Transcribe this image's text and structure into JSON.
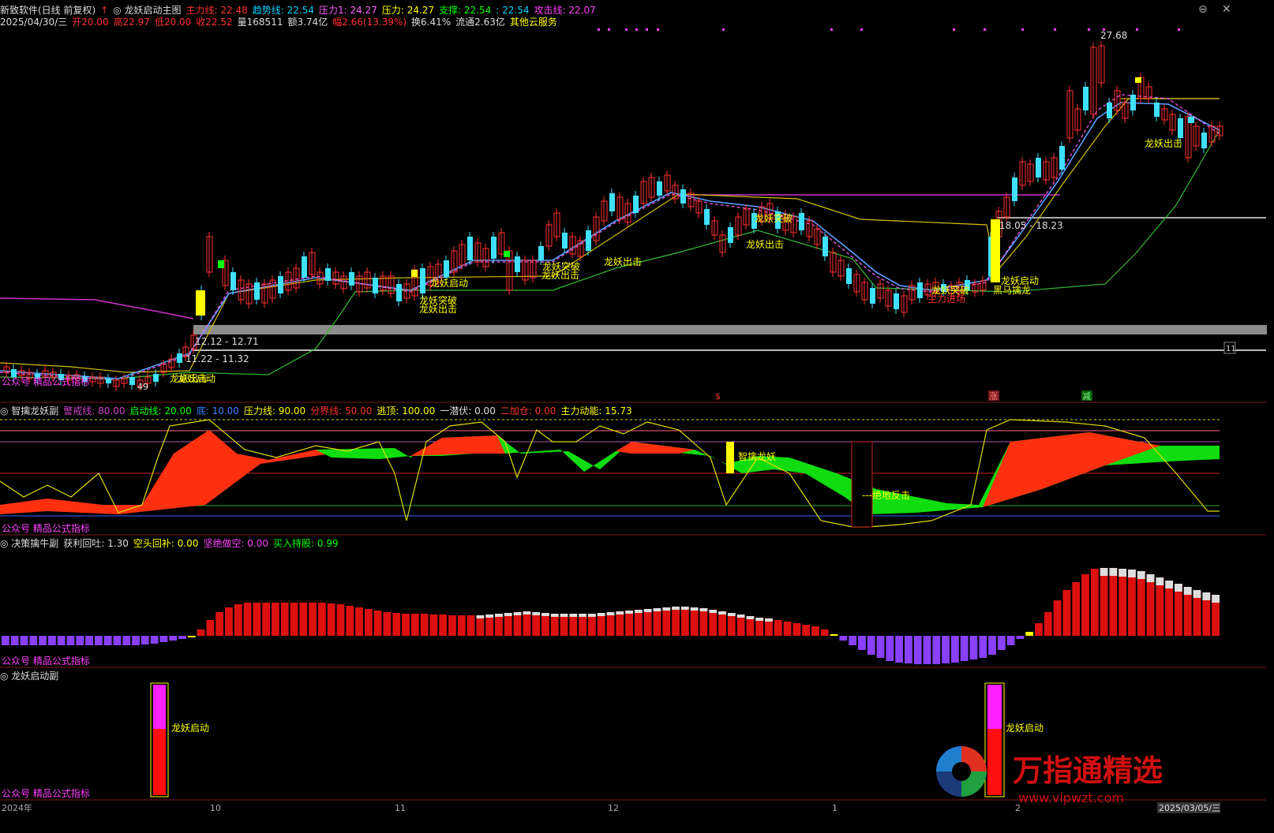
{
  "main": {
    "title_row": [
      {
        "text": "新致软件(日线 前复权)",
        "color": "#dddddd"
      },
      {
        "text": "↑",
        "color": "#ff3030"
      },
      {
        "text": "◎ 龙妖启动主图",
        "color": "#dddddd"
      },
      {
        "text": "主力线: 22.48",
        "color": "#ff3030"
      },
      {
        "text": "趋势线: 22.54",
        "color": "#00d0ff"
      },
      {
        "text": "压力1: 24.27",
        "color": "#ff60ff"
      },
      {
        "text": "压力: 24.27",
        "color": "#ffff00"
      },
      {
        "text": "支撑: 22.54",
        "color": "#00ff00"
      },
      {
        "text": ": 22.54",
        "color": "#00d0ff"
      },
      {
        "text": "攻击线: 22.07",
        "color": "#ff40ff"
      }
    ],
    "info_row": [
      {
        "text": "2025/04/30/三",
        "color": "#dddddd"
      },
      {
        "text": "开20.00",
        "color": "#ff3030"
      },
      {
        "text": "高22.97",
        "color": "#ff3030"
      },
      {
        "text": "低20.00",
        "color": "#ff3030"
      },
      {
        "text": "收22.52",
        "color": "#ff3030"
      },
      {
        "text": "量168511",
        "color": "#dddddd"
      },
      {
        "text": "额3.74亿",
        "color": "#dddddd"
      },
      {
        "text": "幅2.66(13.39%)",
        "color": "#ff3030"
      },
      {
        "text": "换6.41%",
        "color": "#dddddd"
      },
      {
        "text": "流通2.63亿",
        "color": "#dddddd"
      },
      {
        "text": "其他云服务",
        "color": "#ffff00"
      }
    ],
    "max_label": "27.68",
    "range_high": "18.05 - 18.23",
    "range_mid": "12.12 - 12.71",
    "range_low": "11.22 - 11.32",
    "low_label": "49",
    "right_edge_label": "11",
    "signals": [
      {
        "text": "龙妖启动",
        "color": "#ffff00"
      },
      {
        "text": "龙妖突破",
        "color": "#ffff00"
      },
      {
        "text": "龙妖出击",
        "color": "#ffff00"
      },
      {
        "text": "龙妖突破",
        "color": "#ffff00"
      },
      {
        "text": "龙妖出击",
        "color": "#ffff00"
      },
      {
        "text": "龙妖出击",
        "color": "#ffff00"
      },
      {
        "text": "龙妖出击",
        "color": "#ffff00"
      },
      {
        "text": "龙妖突破",
        "color": "#ffff00"
      },
      {
        "text": "主力进场",
        "color": "#ff3030"
      },
      {
        "text": "龙妖启动",
        "color": "#ffff00"
      },
      {
        "text": "黑马擒龙",
        "color": "#ffff00"
      },
      {
        "text": "龙妖出击",
        "color": "#ffff00"
      },
      {
        "text": "龙妖启动",
        "color": "#ffff00"
      },
      {
        "text": "龙妖突破",
        "color": "#ffff00"
      },
      {
        "text": "龙妖出击",
        "color": "#ffff00"
      }
    ],
    "bottom_marks": [
      {
        "text": "$",
        "color": "#ff3030"
      },
      {
        "text": "涨",
        "color": "#ff3030"
      },
      {
        "text": "减",
        "color": "#00ff00"
      }
    ],
    "watermark": "公众号 精品公式指标"
  },
  "panel2": {
    "header": [
      {
        "text": "◎ 智擒龙妖副",
        "color": "#dddddd"
      },
      {
        "text": "警戒线: 80.00",
        "color": "#cc44cc"
      },
      {
        "text": "启动线: 20.00",
        "color": "#00ff00"
      },
      {
        "text": "底: 10.00",
        "color": "#4080ff"
      },
      {
        "text": "压力线: 90.00",
        "color": "#ffff00"
      },
      {
        "text": "分界线: 50.00",
        "color": "#ff3030"
      },
      {
        "text": "逃顶: 100.00",
        "color": "#ffff00"
      },
      {
        "text": "一潜伏: 0.00",
        "color": "#dddddd"
      },
      {
        "text": "二加仓: 0.00",
        "color": "#ff3030"
      },
      {
        "text": "主力动能: 15.73",
        "color": "#ffff00"
      }
    ],
    "label_1": "智擒龙妖",
    "label_2": "---绝地反击",
    "watermark": "公众号 精品公式指标"
  },
  "panel3": {
    "header": [
      {
        "text": "◎ 决策擒牛副",
        "color": "#dddddd"
      },
      {
        "text": "获利回吐: 1.30",
        "color": "#dddddd"
      },
      {
        "text": "空头回补: 0.00",
        "color": "#ffff00"
      },
      {
        "text": "坚绝做空: 0.00",
        "color": "#ff40ff"
      },
      {
        "text": "买入持股: 0.99",
        "color": "#00ff00"
      }
    ],
    "watermark": "公众号 精品公式指标"
  },
  "panel4": {
    "header": "◎ 龙妖启动副",
    "signal_1": "龙妖启动",
    "signal_2": "龙妖启动",
    "watermark": "公众号 精品公式指标"
  },
  "axis": {
    "labels": [
      "2024年",
      "10",
      "11",
      "12",
      "1",
      "2",
      "2025/03/05/三"
    ]
  },
  "brand": {
    "name": "万指通精选",
    "url": "www.vipwzt.com"
  },
  "colors": {
    "up": "#ff3030",
    "down": "#40e0ff",
    "signal_yellow": "#ffff00",
    "support_green": "#00ff00",
    "pressure_magenta": "#ff40ff"
  }
}
